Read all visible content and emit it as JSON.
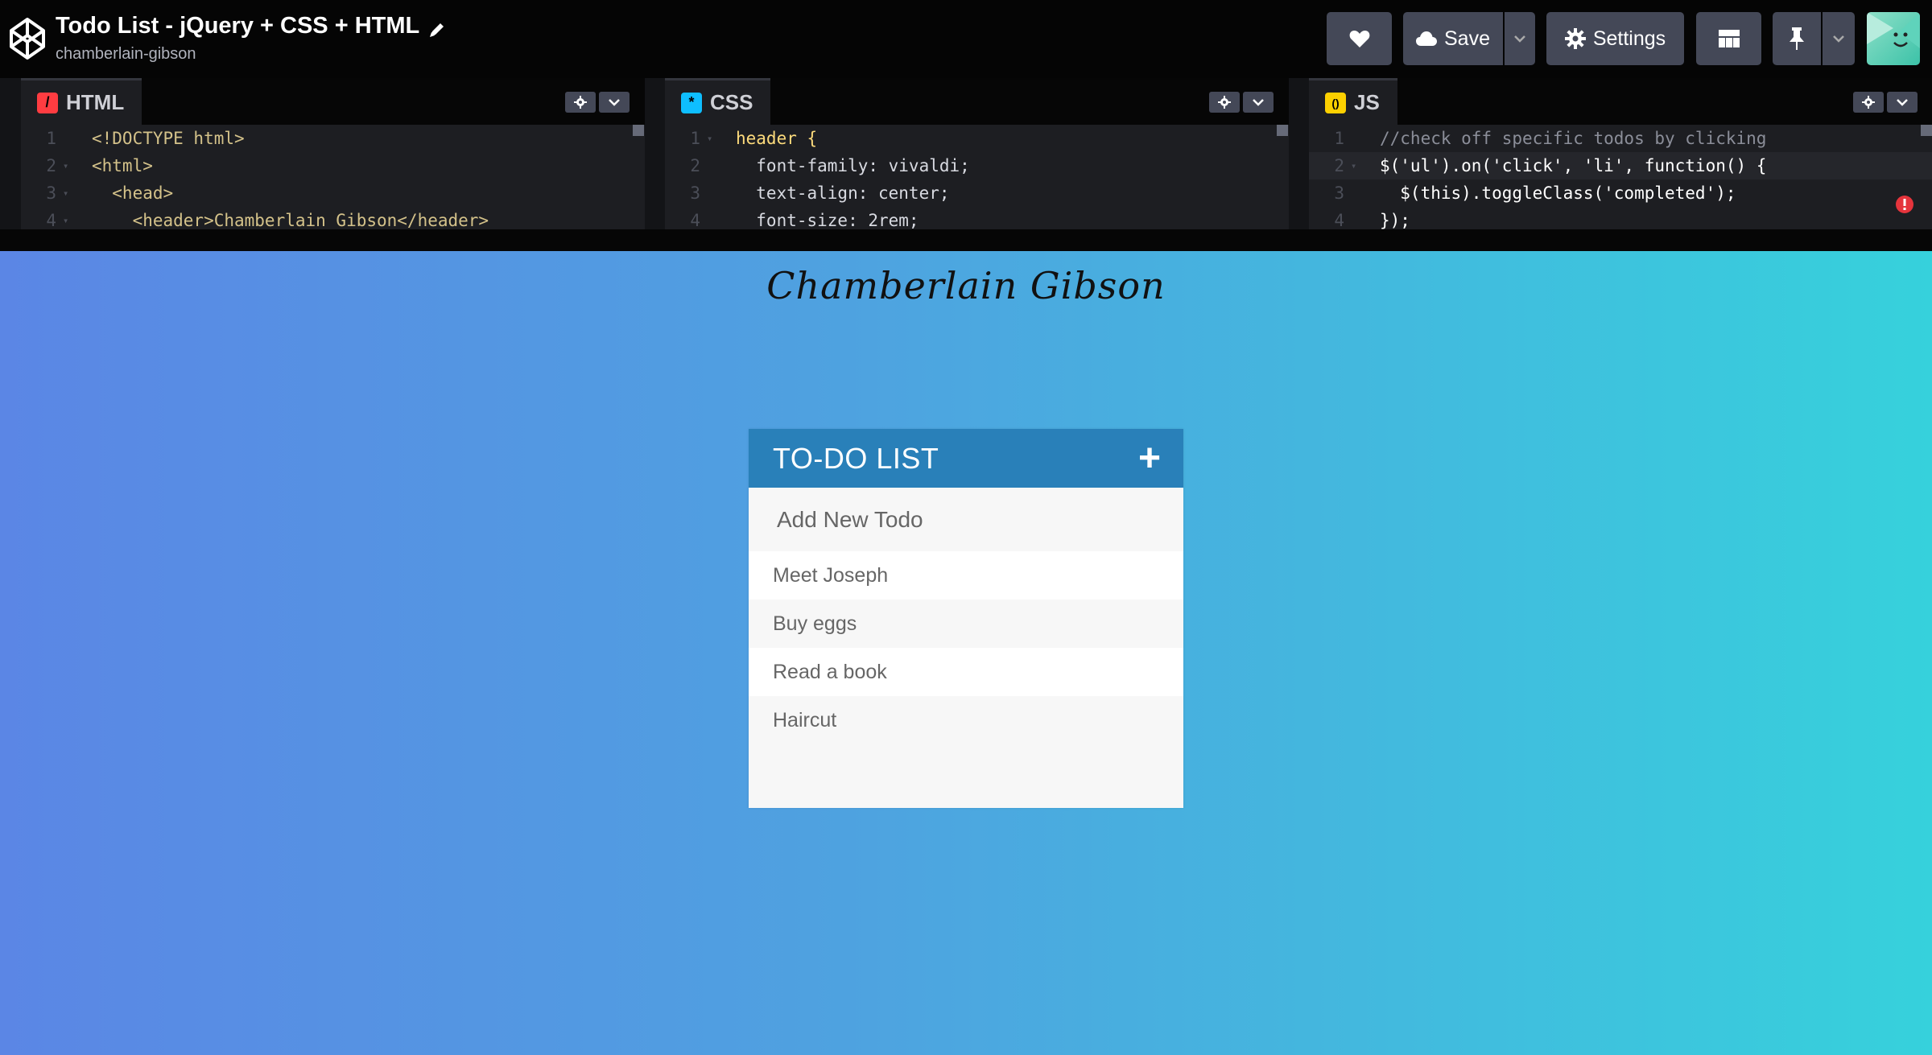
{
  "header": {
    "title": "Todo List - jQuery + CSS + HTML",
    "username": "chamberlain-gibson",
    "save_label": "Save",
    "settings_label": "Settings"
  },
  "editors": {
    "html": {
      "label": "HTML",
      "badge": "/",
      "badge_color": "#ff3c41",
      "lines": [
        {
          "n": "1",
          "fold": "",
          "code": "<!DOCTYPE html>"
        },
        {
          "n": "2",
          "fold": "▾",
          "code": "<html>"
        },
        {
          "n": "3",
          "fold": "▾",
          "code": "  <head>"
        },
        {
          "n": "4",
          "fold": "▾",
          "code": "    <header>Chamberlain Gibson</header>"
        }
      ]
    },
    "css": {
      "label": "CSS",
      "badge": "*",
      "badge_color": "#0ebeff",
      "lines": [
        {
          "n": "1",
          "fold": "▾",
          "code": "header {"
        },
        {
          "n": "2",
          "fold": "",
          "code": "  font-family: vivaldi;"
        },
        {
          "n": "3",
          "fold": "",
          "code": "  text-align: center;"
        },
        {
          "n": "4",
          "fold": "",
          "code": "  font-size: 2rem;"
        }
      ]
    },
    "js": {
      "label": "JS",
      "badge": "()",
      "badge_color": "#fcd000",
      "lines": [
        {
          "n": "1",
          "fold": "",
          "code": "//check off specific todos by clicking"
        },
        {
          "n": "2",
          "fold": "▾",
          "code": "$('ul').on('click', 'li', function() {"
        },
        {
          "n": "3",
          "fold": "",
          "code": "  $(this).toggleClass('completed');"
        },
        {
          "n": "4",
          "fold": "",
          "code": "});"
        }
      ]
    }
  },
  "preview": {
    "header_text": "Chamberlain Gibson",
    "todo_title": "TO-DO LIST",
    "plus_icon": "+",
    "input_placeholder": "Add New Todo",
    "items": [
      "Meet Joseph",
      "Buy eggs",
      "Read a book",
      "Haircut"
    ]
  },
  "colors": {
    "todo_header": "#2980b9",
    "gradient_start": "#5b86e5",
    "gradient_end": "#36d1dc"
  }
}
